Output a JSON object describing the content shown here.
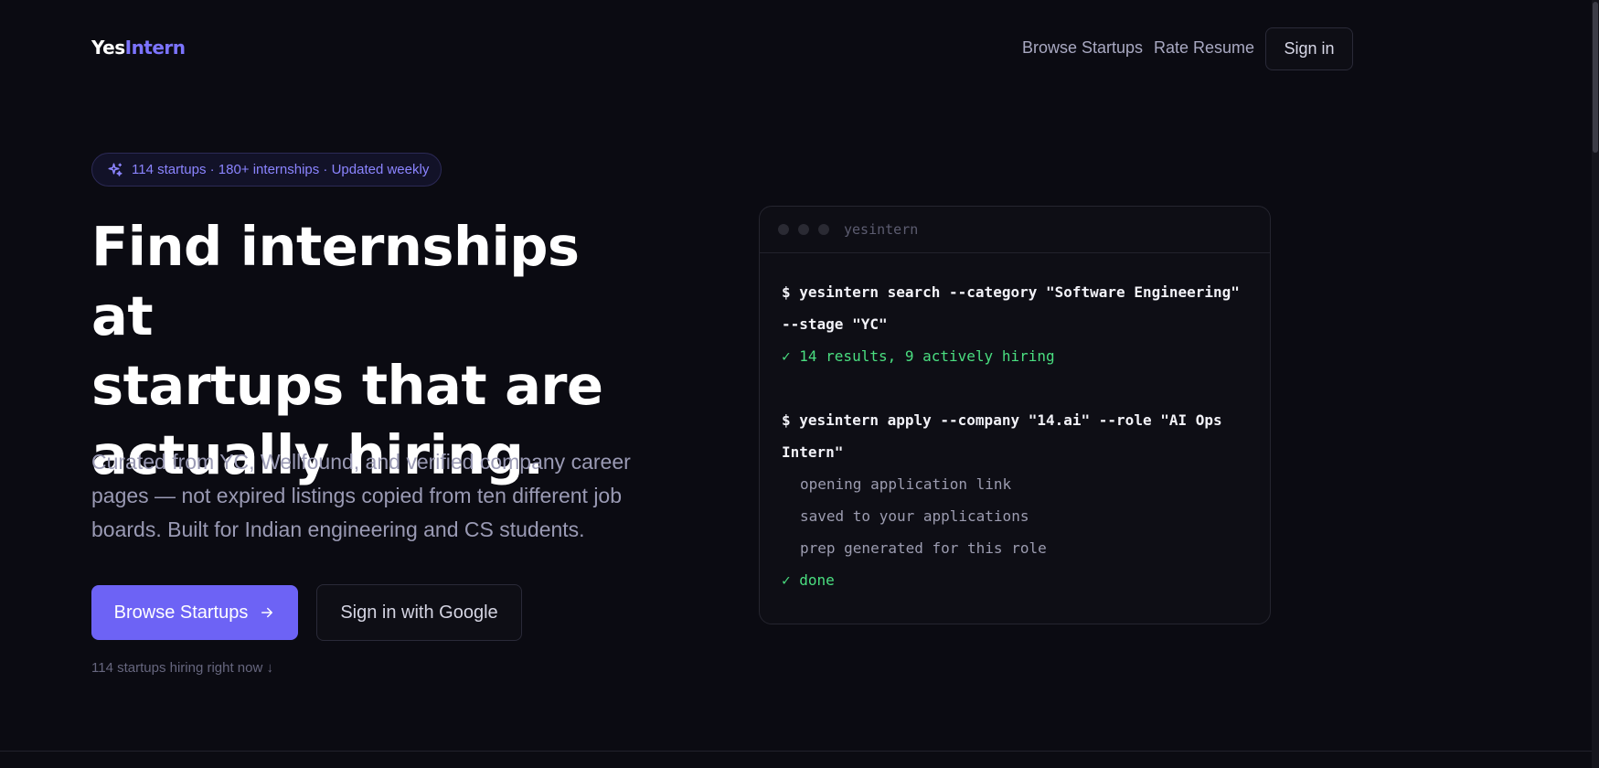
{
  "nav": {
    "logo_part1": "Yes",
    "logo_part2": "Intern",
    "links": [
      "Browse Startups",
      "Rate Resume"
    ],
    "signin": "Sign in"
  },
  "hero": {
    "pill_text": "114 startups · 180+ internships · Updated weekly",
    "title_lines": [
      "Find internships at",
      "startups that are",
      "actually hiring."
    ],
    "subtitle": "Curated from YC, Wellfound, and verified company career pages — not expired listings copied from ten different job boards. Built for Indian engineering and CS students.",
    "primary_button": "Browse Startups",
    "secondary_button": "Sign in with Google",
    "hint": "114 startups hiring right now ↓"
  },
  "terminal": {
    "title": "yesintern",
    "cmd1": "$ yesintern search --category \"Software Engineering\" --stage \"YC\"",
    "result1": "✓ 14 results, 9 actively hiring",
    "cmd2": "$ yesintern apply --company \"14.ai\" --role \"AI Ops Intern\"",
    "out_lines": [
      "opening application link",
      "saved to your applications",
      "prep generated for this role"
    ],
    "done": "✓ done"
  },
  "colors": {
    "background": "#0b0b12",
    "accent": "#6d63f5",
    "success": "#4ade80"
  }
}
